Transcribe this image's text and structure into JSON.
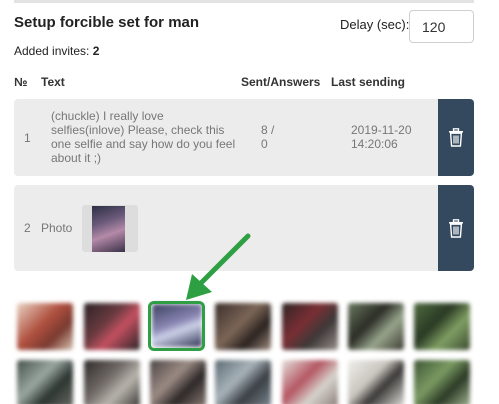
{
  "header": {
    "title": "Setup forcible set for man",
    "delay_label": "Delay (sec):",
    "delay_value": "120"
  },
  "invites": {
    "label": "Added invites:",
    "count": "2"
  },
  "table": {
    "columns": [
      "№",
      "Text",
      "Sent/Answers",
      "Last sending"
    ],
    "rows": [
      {
        "num": "1",
        "text": "(chuckle) I really love selfies(inlove) Please, check this one selfie and say how do you feel about it ;)",
        "sent": "8 /",
        "answers": "0",
        "date": "2019-11-20",
        "time": "14:20:06"
      },
      {
        "num": "2",
        "text": "Photo"
      }
    ]
  },
  "icons": {
    "delete": "trash-icon",
    "pointer": "arrow-icon"
  },
  "colors": {
    "delete_button": "#34495e",
    "row_bg": "#ececec",
    "selection": "#2ea043"
  }
}
